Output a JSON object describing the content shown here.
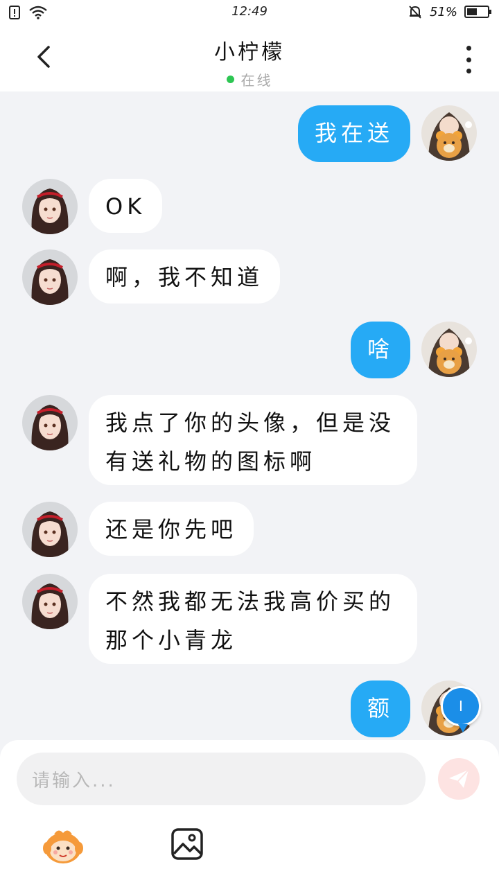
{
  "status_bar": {
    "time": "12:49",
    "battery_percent": "51%",
    "battery_level": 0.51,
    "icons": [
      "sim-alert-icon",
      "wifi-icon",
      "mute-bell-icon",
      "battery-icon"
    ]
  },
  "header": {
    "title": "小柠檬",
    "status": "在线",
    "status_color": "#2dc653"
  },
  "messages": [
    {
      "side": "out",
      "text_lines": [
        "我在送"
      ],
      "avatar": "user-avatar"
    },
    {
      "side": "in",
      "text_lines": [
        "OK"
      ],
      "avatar": "contact-avatar"
    },
    {
      "side": "in",
      "text_lines": [
        "啊，我不知道"
      ],
      "avatar": "contact-avatar"
    },
    {
      "side": "out",
      "text_lines": [
        "啥"
      ],
      "avatar": "user-avatar"
    },
    {
      "side": "in",
      "text_lines": [
        "我点了你的头像，但是没",
        "有送礼物的图标啊"
      ],
      "avatar": "contact-avatar"
    },
    {
      "side": "in",
      "text_lines": [
        "还是你先吧"
      ],
      "avatar": "contact-avatar"
    },
    {
      "side": "in",
      "text_lines": [
        "不然我都无法我高价买的",
        "那个小青龙"
      ],
      "avatar": "contact-avatar"
    },
    {
      "side": "out",
      "text_lines": [
        "额"
      ],
      "avatar": "user-avatar"
    }
  ],
  "input": {
    "placeholder": "请输入..."
  },
  "floating_badge": {
    "text": "I"
  },
  "colors": {
    "accent": "#26aaf5",
    "background": "#f2f3f6",
    "send_button": "#fde3e2"
  }
}
